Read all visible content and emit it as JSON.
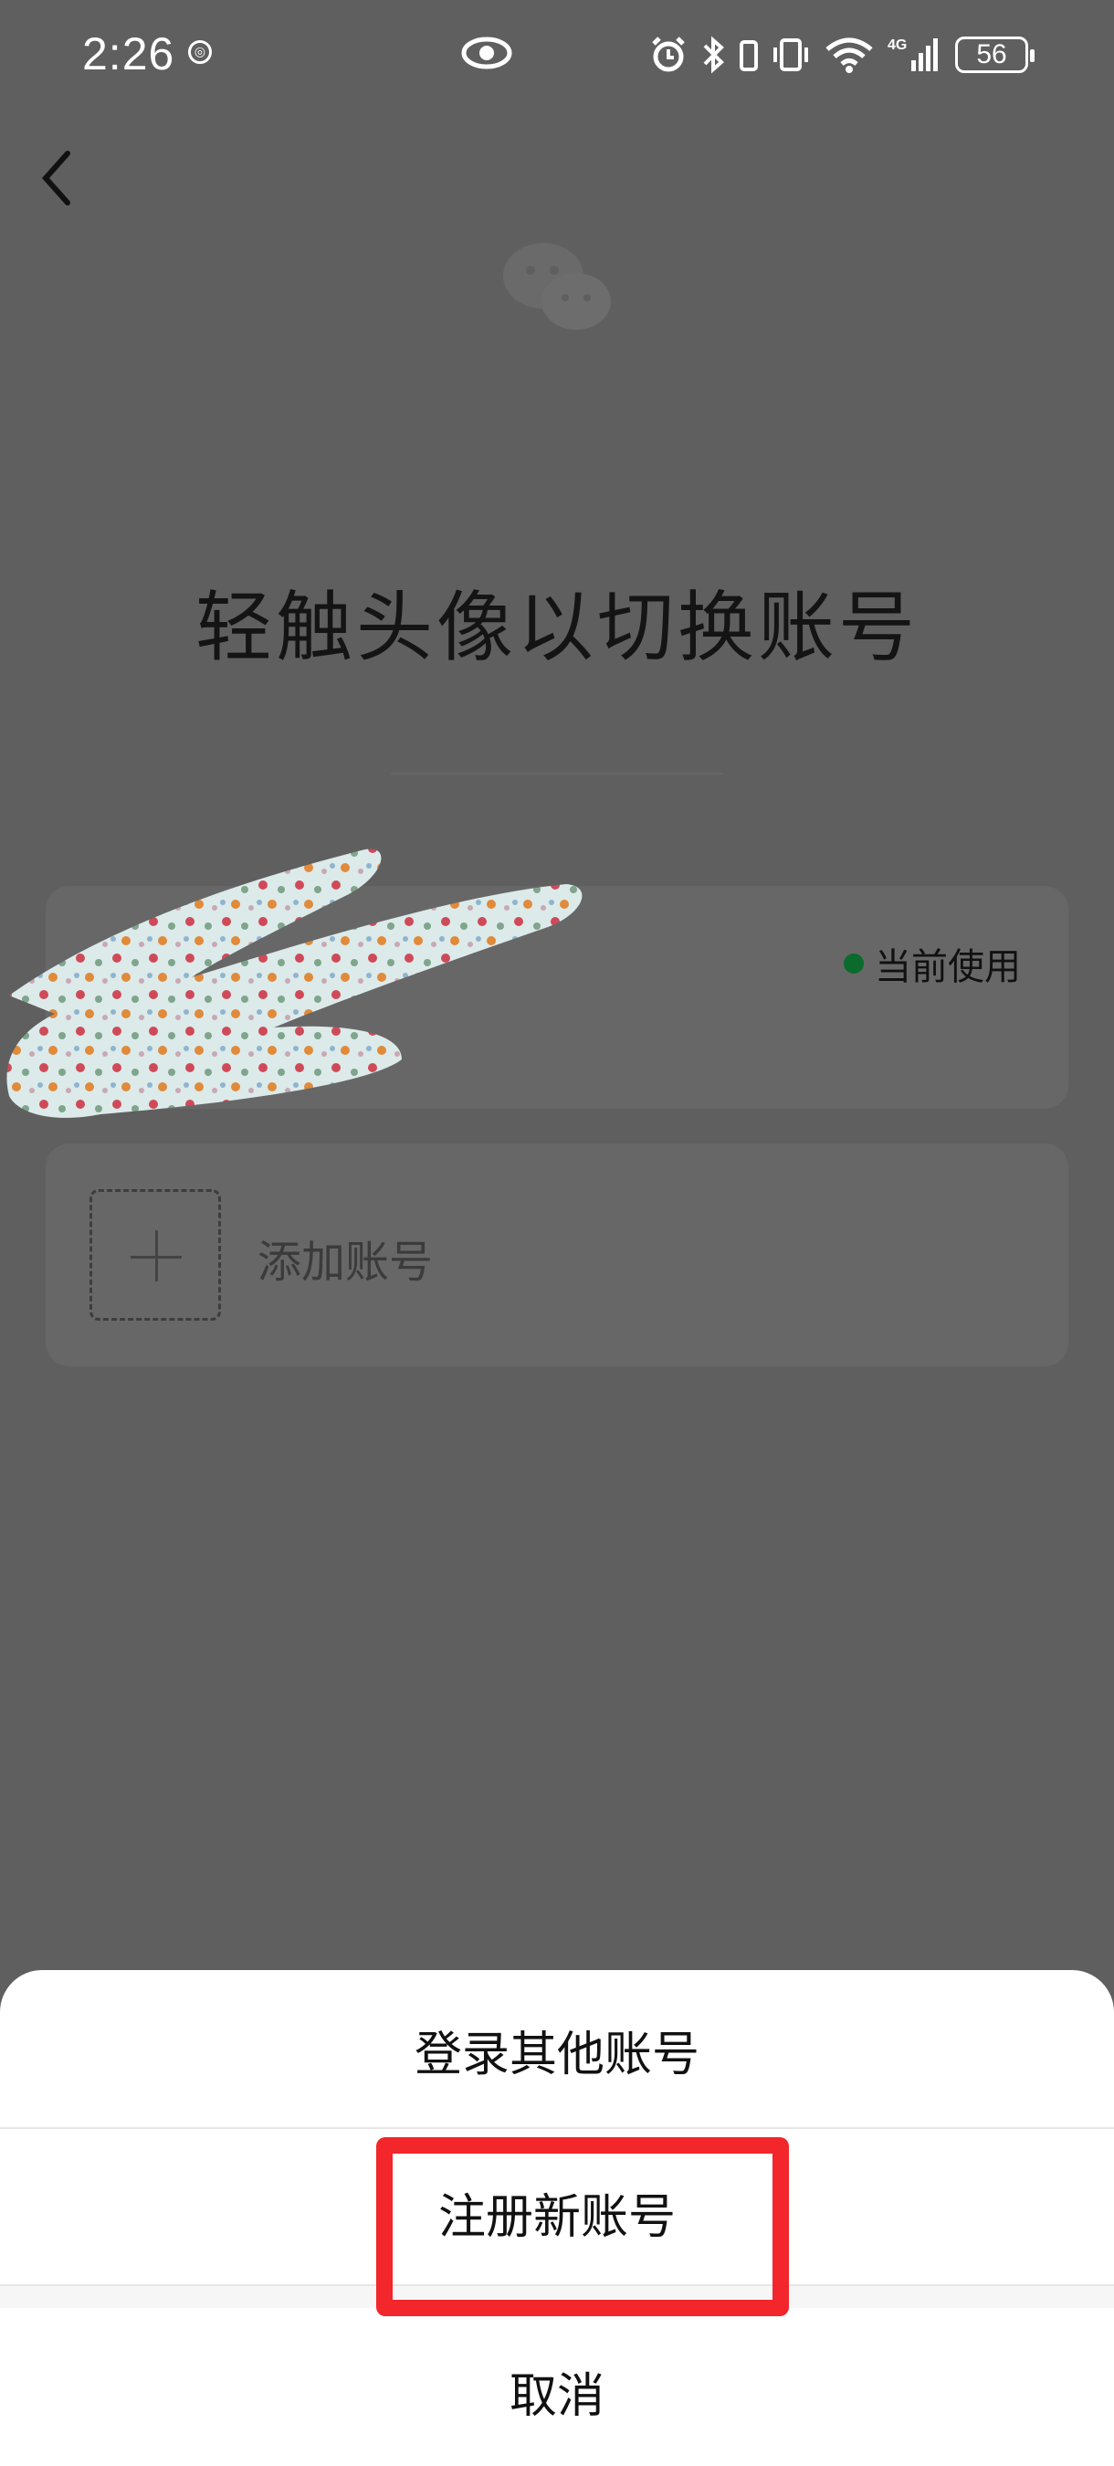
{
  "status_bar": {
    "time": "2:26",
    "battery": "56",
    "network": "4G"
  },
  "page": {
    "title": "轻触头像以切换账号",
    "current_account_badge": "当前使用",
    "add_account_label": "添加账号"
  },
  "bottom_sheet": {
    "login_other": "登录其他账号",
    "register_new": "注册新账号",
    "cancel": "取消"
  },
  "colors": {
    "overlay": "#5f5f5f",
    "current_dot": "#0a6b2c",
    "highlight": "#f2262b"
  }
}
